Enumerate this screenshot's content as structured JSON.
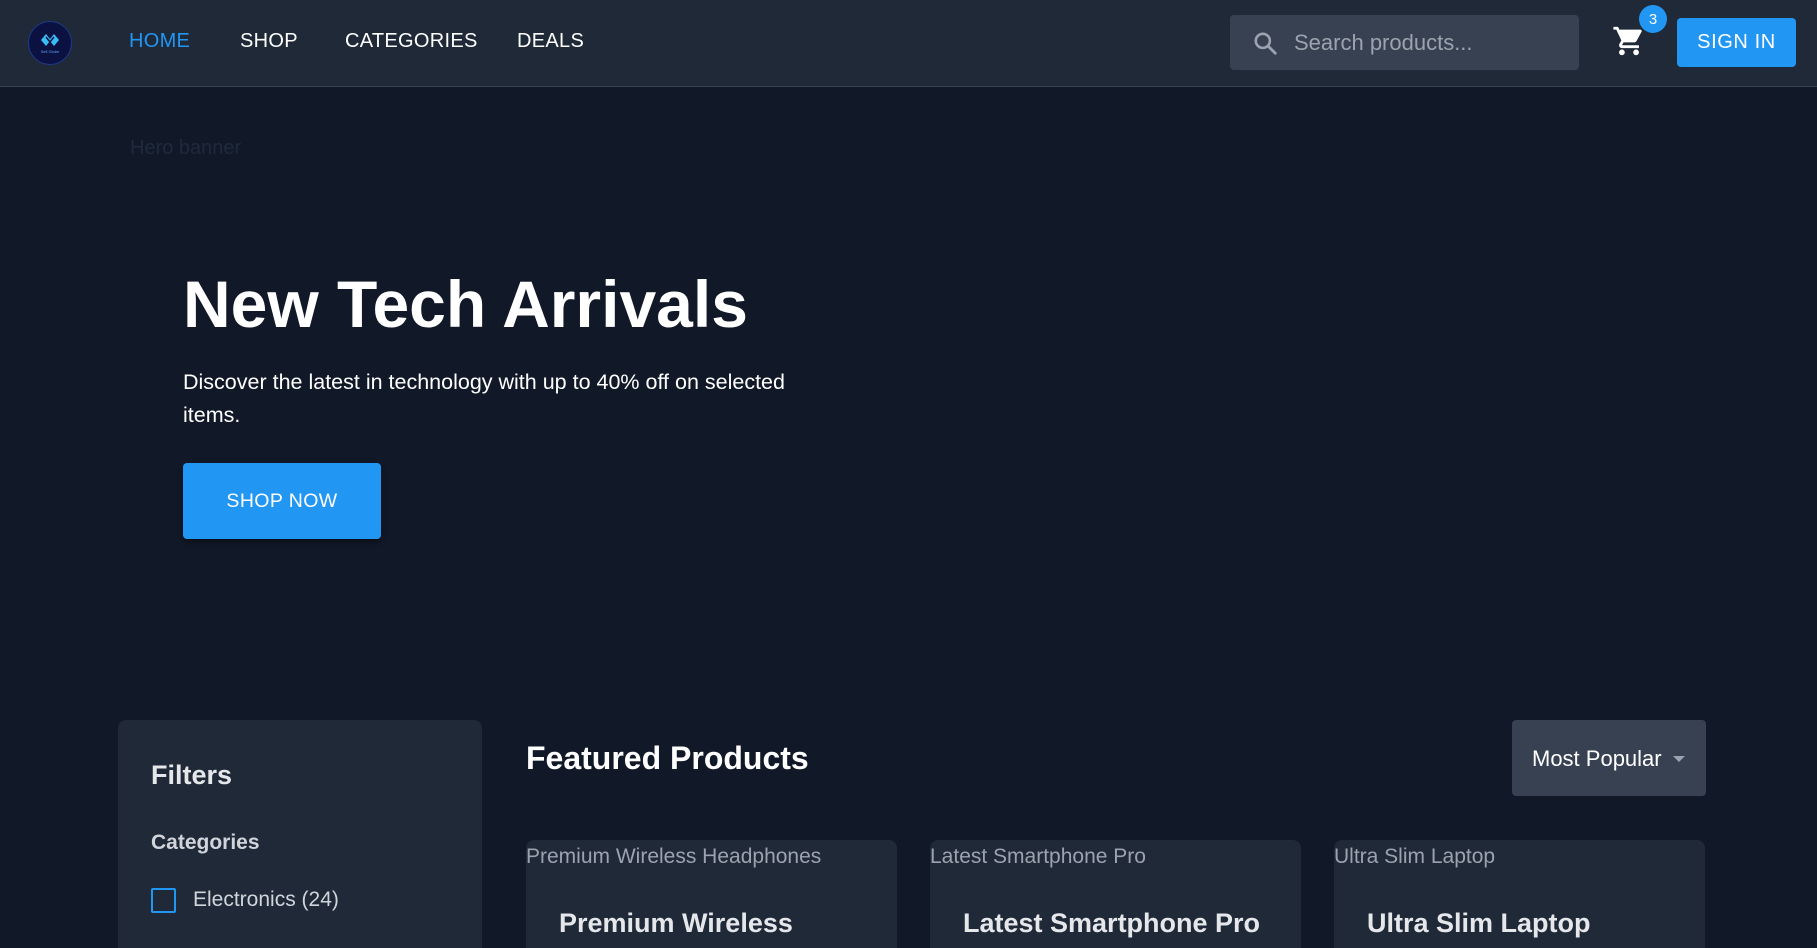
{
  "brand": {
    "logo_text": "Sell Globe"
  },
  "nav": {
    "links": [
      {
        "label": "HOME",
        "active": true
      },
      {
        "label": "SHOP",
        "active": false
      },
      {
        "label": "CATEGORIES",
        "active": false
      },
      {
        "label": "DEALS",
        "active": false
      }
    ]
  },
  "search": {
    "placeholder": "Search products...",
    "value": "",
    "icon": "search-icon"
  },
  "cart": {
    "count": "3",
    "icon": "shopping-cart-icon"
  },
  "auth": {
    "sign_in_label": "SIGN IN"
  },
  "hero": {
    "image_alt": "Hero banner",
    "title": "New Tech Arrivals",
    "subtitle": "Discover the latest in technology with up to 40% off on selected items.",
    "cta_label": "SHOP NOW"
  },
  "filters": {
    "title": "Filters",
    "categories_heading": "Categories",
    "categories": [
      {
        "label": "Electronics (24)",
        "checked": false
      }
    ]
  },
  "products": {
    "heading": "Featured Products",
    "sort_label": "Most Popular",
    "items": [
      {
        "image_alt": "Premium Wireless Headphones",
        "title": "Premium Wireless"
      },
      {
        "image_alt": "Latest Smartphone Pro",
        "title": "Latest Smartphone Pro"
      },
      {
        "image_alt": "Ultra Slim Laptop",
        "title": "Ultra Slim Laptop"
      }
    ]
  },
  "colors": {
    "accent": "#2196f3",
    "background": "#111827",
    "surface": "#1f2937",
    "input": "#374151"
  }
}
